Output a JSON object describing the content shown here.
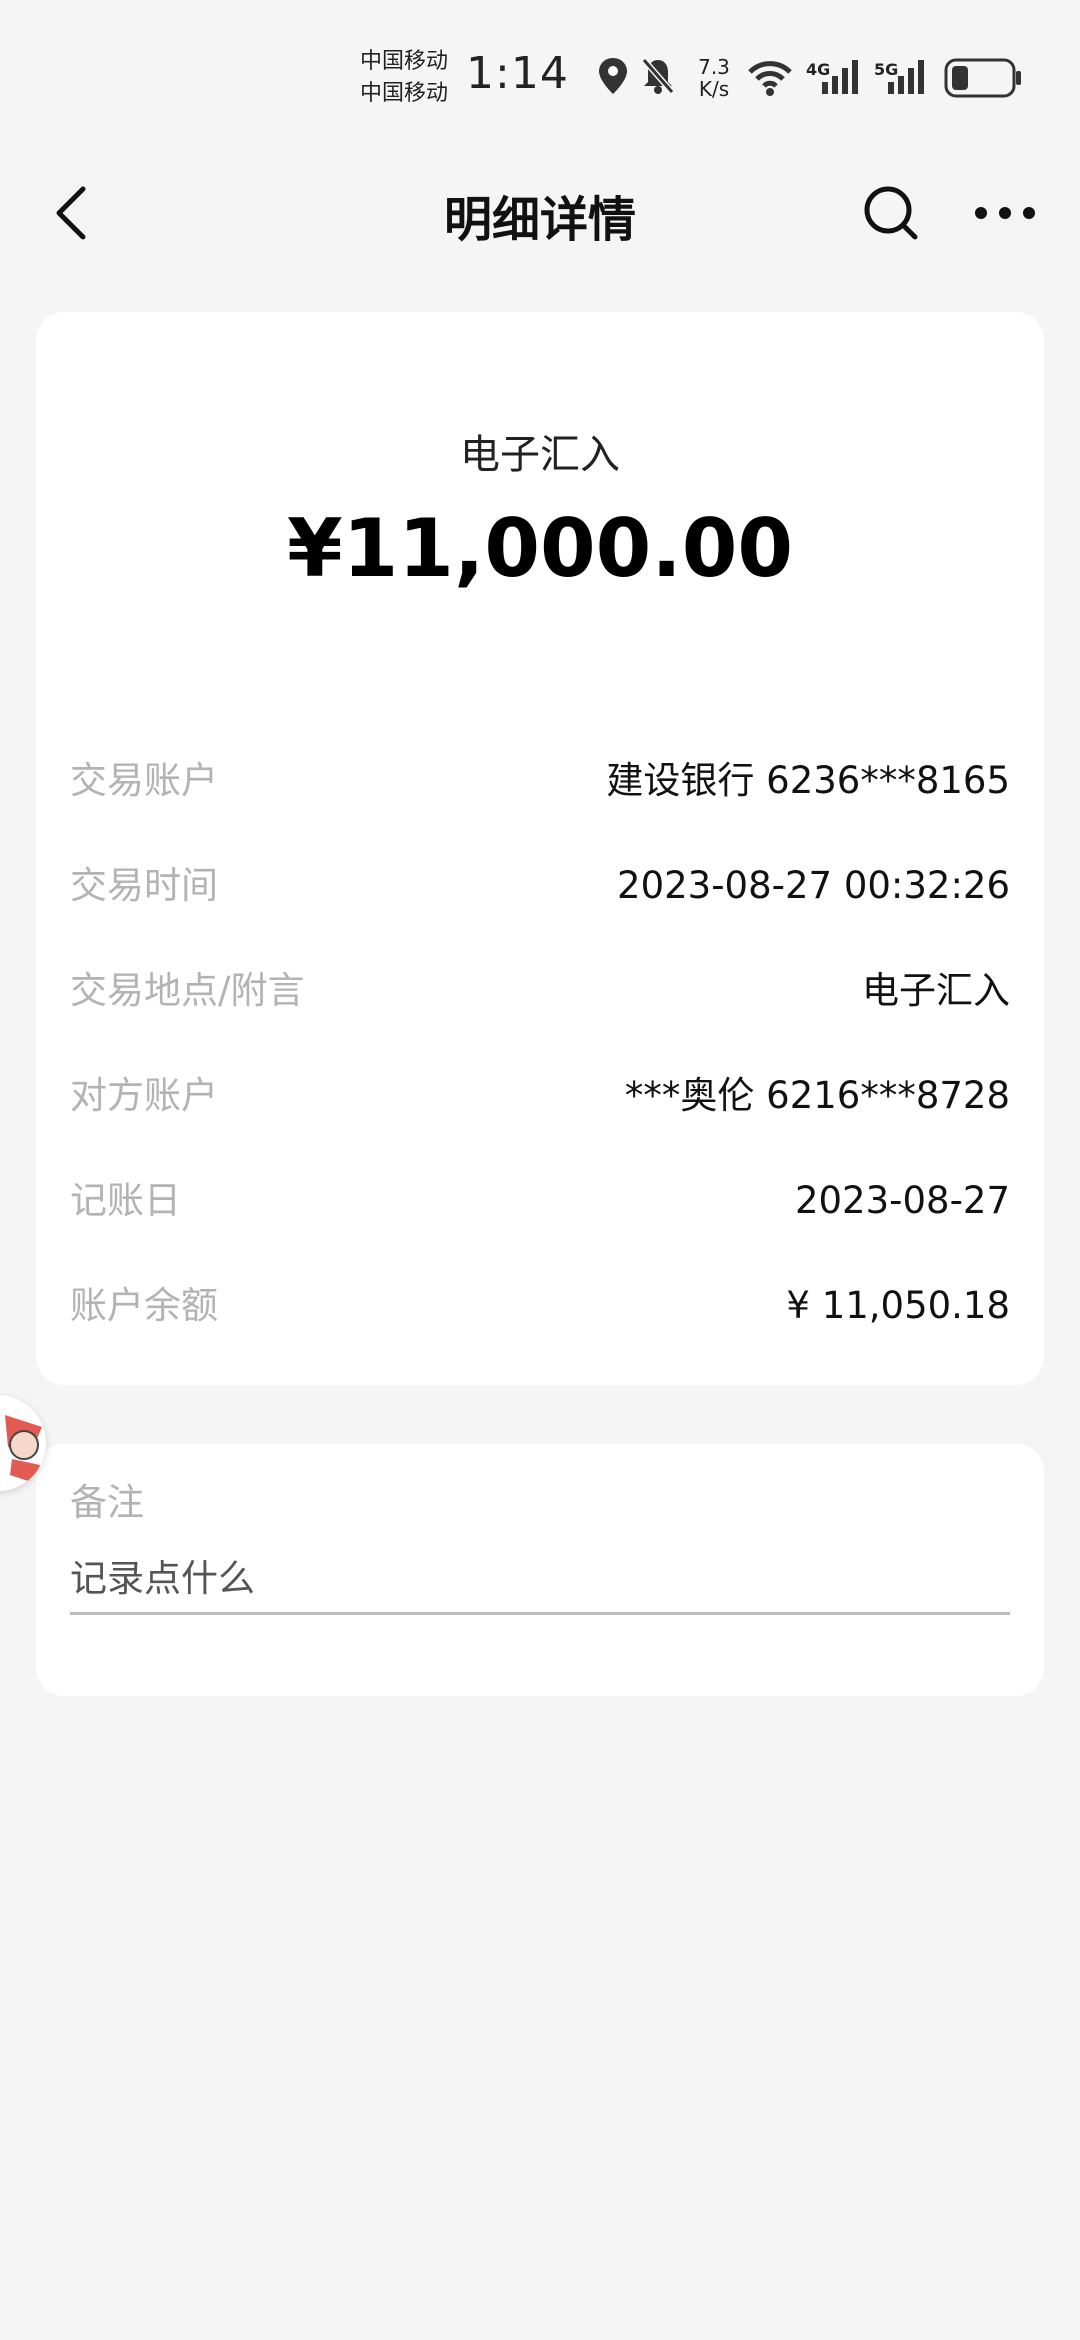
{
  "status_bar": {
    "carrier_1": "中国移动",
    "carrier_2": "中国移动",
    "time": "1:14",
    "speed_value": "7.3",
    "speed_unit": "K/s",
    "net_1": "4G",
    "net_2": "5G",
    "icons": [
      "location-icon",
      "mute-bell-icon",
      "wifi-icon",
      "signal-icon",
      "battery-icon"
    ]
  },
  "header": {
    "title": "明细详情",
    "icons": [
      "back-icon",
      "search-icon",
      "more-icon"
    ]
  },
  "transaction": {
    "type": "电子汇入",
    "amount": "¥11,000.00",
    "rows": [
      {
        "label": "交易账户",
        "value": "建设银行 6236***8165"
      },
      {
        "label": "交易时间",
        "value": "2023-08-27 00:32:26"
      },
      {
        "label": "交易地点/附言",
        "value": "电子汇入"
      },
      {
        "label": "对方账户",
        "value": "***奥伦 6216***8728"
      },
      {
        "label": "记账日",
        "value": "2023-08-27"
      },
      {
        "label": "账户余额",
        "value": "¥ 11,050.18"
      }
    ]
  },
  "note": {
    "label": "备注",
    "placeholder": "记录点什么"
  },
  "colors": {
    "background": "#f5f5f5",
    "card": "#ffffff",
    "label_gray": "#b3b3b3",
    "text_dark": "#111111"
  }
}
